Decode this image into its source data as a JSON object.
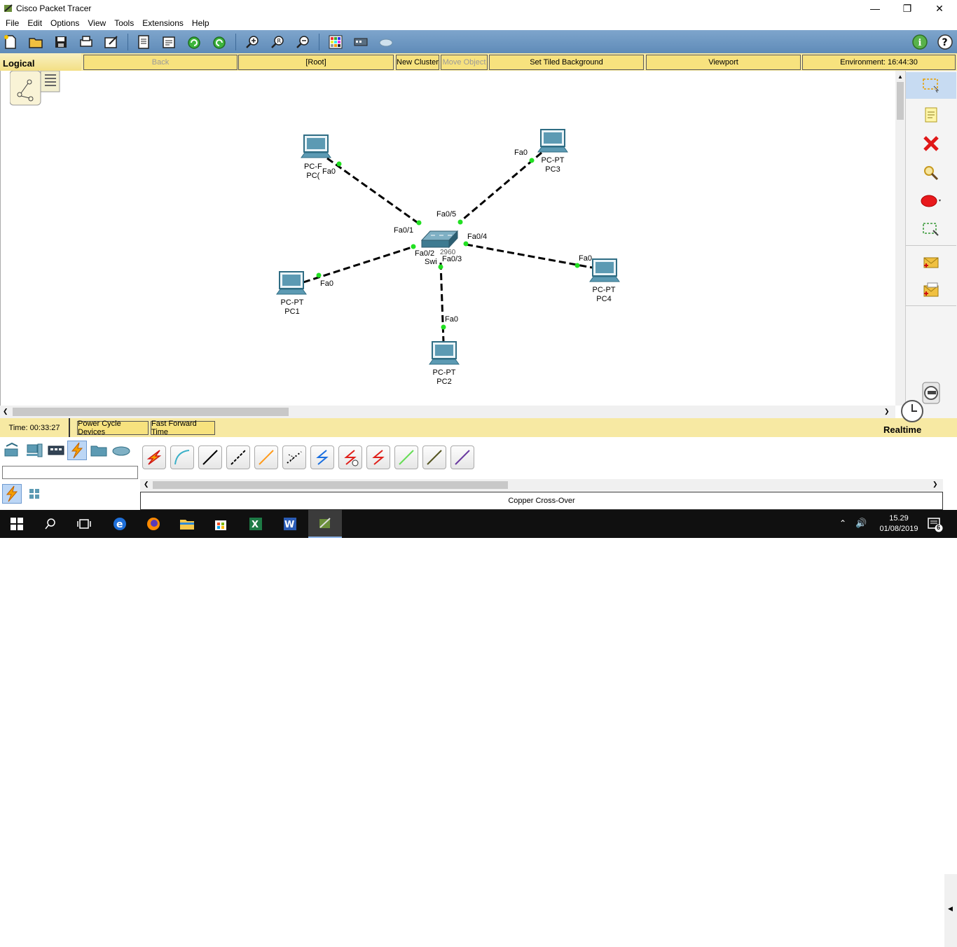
{
  "window": {
    "title": "Cisco Packet Tracer"
  },
  "menu": [
    "File",
    "Edit",
    "Options",
    "View",
    "Tools",
    "Extensions",
    "Help"
  ],
  "logical_bar": {
    "tab_label": "Logical",
    "back": "Back",
    "root": "[Root]",
    "new_cluster": "New Cluster",
    "move_object": "Move Object",
    "set_tiled_background": "Set Tiled Background",
    "viewport": "Viewport",
    "environment": "Environment: 16:44:30"
  },
  "topology": {
    "switch": {
      "type_label": "2960",
      "name_label": "Swi"
    },
    "devices": [
      {
        "id": "pc0",
        "type_label": "PC-F",
        "name_label": "PC("
      },
      {
        "id": "pc1",
        "type_label": "PC-PT",
        "name_label": "PC1"
      },
      {
        "id": "pc2",
        "type_label": "PC-PT",
        "name_label": "PC2"
      },
      {
        "id": "pc3",
        "type_label": "PC-PT",
        "name_label": "PC3"
      },
      {
        "id": "pc4",
        "type_label": "PC-PT",
        "name_label": "PC4"
      }
    ],
    "port_labels": {
      "pc0_fa0": "Fa0",
      "pc1_fa0": "Fa0",
      "pc2_fa0": "Fa0",
      "pc3_fa0": "Fa0",
      "pc4_fa0": "Fa0",
      "sw_fa01": "Fa0/1",
      "sw_fa02": "Fa0/2",
      "sw_fa03": "Fa0/3",
      "sw_fa04": "Fa0/4",
      "sw_fa05": "Fa0/5"
    },
    "link_style": "dashed-black",
    "link_endpoint_color": "#22e022"
  },
  "status": {
    "time": "Time: 00:33:27",
    "power_cycle": "Power Cycle Devices",
    "fast_forward": "Fast Forward Time",
    "mode": "Realtime"
  },
  "device_panel": {
    "categories": [
      "network-devices-icon",
      "end-devices-icon",
      "components-icon",
      "connections-icon",
      "miscellaneous-icon",
      "multiuser-icon"
    ],
    "selected_category": "connections-icon",
    "cables": [
      {
        "name": "automatic",
        "color": "#e8a000"
      },
      {
        "name": "console",
        "color": "#3ab0c8"
      },
      {
        "name": "copper-straight",
        "color": "#000000"
      },
      {
        "name": "copper-cross",
        "color": "#000000"
      },
      {
        "name": "fiber",
        "color": "#ff9a1a"
      },
      {
        "name": "phone",
        "color": "#000000"
      },
      {
        "name": "coaxial",
        "color": "#1a6fe0"
      },
      {
        "name": "serial-dce",
        "color": "#e0201a"
      },
      {
        "name": "serial-dte",
        "color": "#e0201a"
      },
      {
        "name": "octal",
        "color": "#66dd55"
      },
      {
        "name": "iot-custom",
        "color": "#555522"
      },
      {
        "name": "usb",
        "color": "#6a3aa0"
      }
    ],
    "selected_cable_name": "Copper Cross-Over"
  },
  "taskbar": {
    "time": "15.29",
    "date": "01/08/2019",
    "notification_count": "6"
  }
}
